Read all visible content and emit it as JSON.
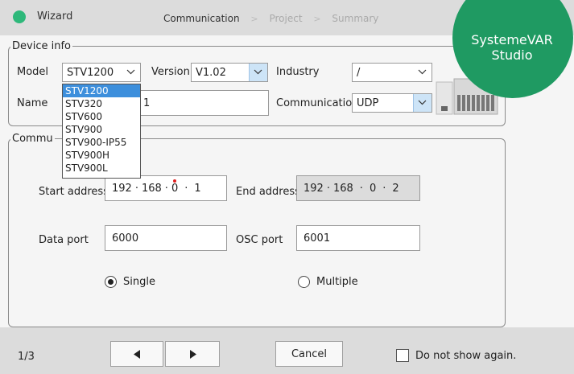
{
  "window": {
    "title": "Wizard"
  },
  "steps": {
    "current": "Communication",
    "next": "Project",
    "last": "Summary",
    "separator": ">"
  },
  "brand": {
    "line1": "SystemeVAR",
    "line2": "Studio",
    "color": "#1f9a62"
  },
  "device_info": {
    "legend": "Device info",
    "model_label": "Model",
    "model_value": "STV1200",
    "version_label": "Version",
    "version_value": "V1.02",
    "industry_label": "Industry",
    "industry_value": "/",
    "name_label": "Name",
    "name_value": "1",
    "communication_label": "Communication",
    "communication_value": "UDP"
  },
  "model_dropdown": {
    "options": [
      "STV1200",
      "STV320",
      "STV600",
      "STV900",
      "STV900-IP55",
      "STV900H",
      "STV900L"
    ],
    "selected": "STV1200"
  },
  "communication": {
    "legend": "Commu",
    "start_address_label": "Start address",
    "start_ip": [
      "192",
      "168",
      "0",
      "1"
    ],
    "end_address_label": "End address",
    "end_ip": [
      "192",
      "168",
      "0",
      "2"
    ],
    "ip_separator": "·",
    "data_port_label": "Data port",
    "data_port_value": "6000",
    "osc_port_label": "OSC port",
    "osc_port_value": "6001",
    "single_label": "Single",
    "multiple_label": "Multiple",
    "selected_mode": "Single"
  },
  "footer": {
    "page": "1/3",
    "cancel_label": "Cancel",
    "dont_show_label": "Do not show again.",
    "dont_show_checked": false
  },
  "icons": {
    "title": "app-dot-icon",
    "prev": "arrow-left-icon",
    "next": "arrow-right-icon",
    "dropdown": "chevron-down-icon"
  }
}
